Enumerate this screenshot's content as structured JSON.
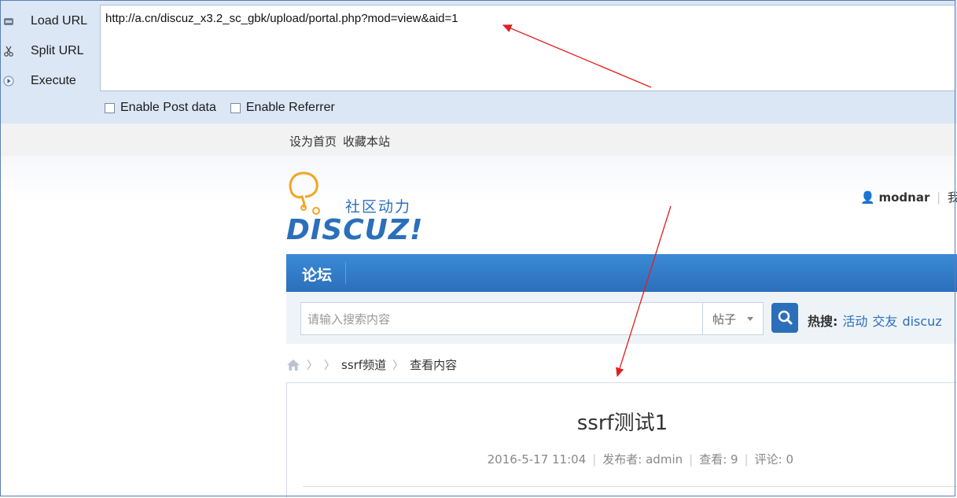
{
  "hackbar": {
    "menu": [
      {
        "label": "Load URL",
        "icon": "load-url-icon"
      },
      {
        "label": "Split URL",
        "icon": "scissors-icon"
      },
      {
        "label": "Execute",
        "icon": "execute-play-icon"
      }
    ],
    "url": "http://a.cn/discuz_x3.2_sc_gbk/upload/portal.php?mod=view&aid=1",
    "enable_post_label": "Enable Post data",
    "enable_referrer_label": "Enable Referrer"
  },
  "topbar": {
    "set_home": "设为首页",
    "bookmark": "收藏本站"
  },
  "logo": {
    "tagline": "社区动力",
    "wordmark": "DISCUZ!"
  },
  "user": {
    "name": "modnar",
    "sep": "|",
    "next": "我的"
  },
  "nav": {
    "forum": "论坛"
  },
  "search": {
    "placeholder": "请输入搜索内容",
    "type": "帖子",
    "hot_label": "热搜:",
    "hot_items": [
      "活动",
      "交友",
      "discuz"
    ]
  },
  "breadcrumb": {
    "channel": "ssrf频道",
    "current": "查看内容"
  },
  "article": {
    "title": "ssrf测试1",
    "date": "2016-5-17 11:04",
    "author_label": "发布者: admin",
    "views": "查看: 9",
    "comments": "评论: 0"
  },
  "colors": {
    "hackbar_bg": "#dbe7f5",
    "nav_blue": "#2b6fba",
    "annotation_red": "#e02020"
  }
}
